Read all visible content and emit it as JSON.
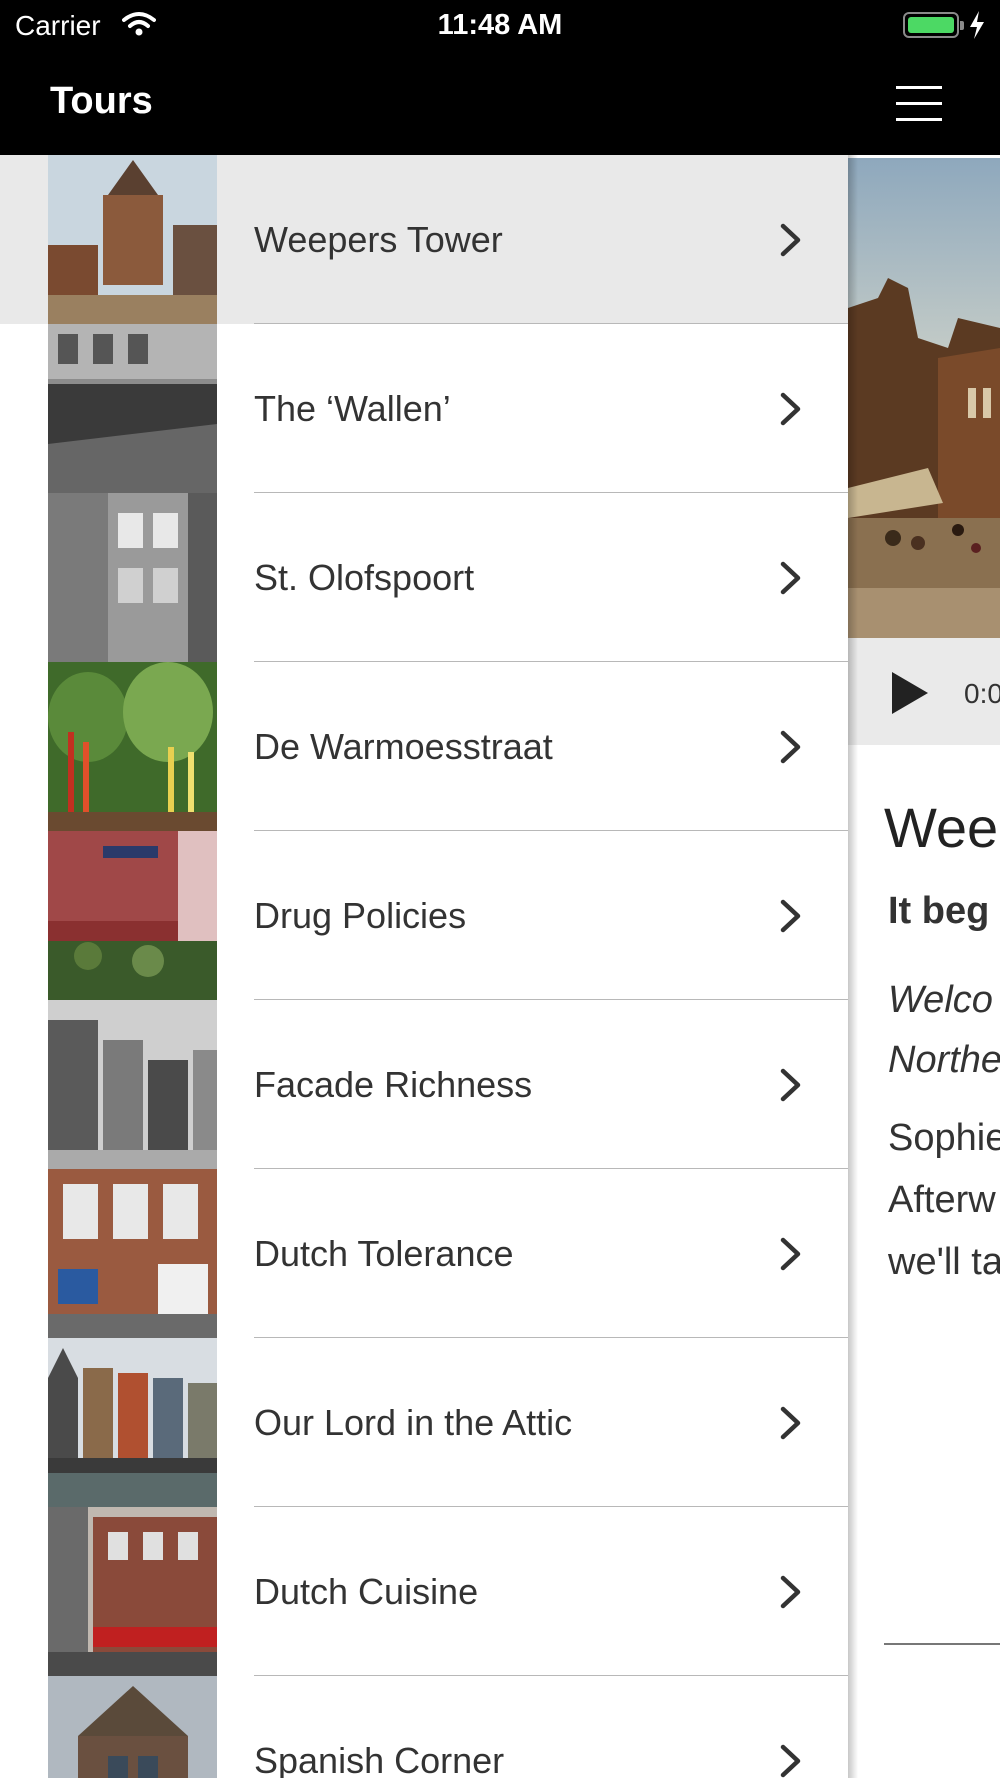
{
  "status_bar": {
    "carrier": "Carrier",
    "time": "11:48 AM"
  },
  "nav": {
    "title": "Tours",
    "menu_icon": "hamburger-menu-icon"
  },
  "tours": [
    {
      "label": "Weepers Tower",
      "selected": true
    },
    {
      "label": "The ‘Wallen’",
      "selected": false
    },
    {
      "label": "St. Olofspoort",
      "selected": false
    },
    {
      "label": "De Warmoesstraat",
      "selected": false
    },
    {
      "label": "Drug Policies",
      "selected": false
    },
    {
      "label": "Facade Richness",
      "selected": false
    },
    {
      "label": "Dutch Tolerance",
      "selected": false
    },
    {
      "label": "Our Lord in the Attic",
      "selected": false
    },
    {
      "label": "Dutch Cuisine",
      "selected": false
    },
    {
      "label": "Spanish Corner",
      "selected": false
    }
  ],
  "detail": {
    "player_time": "0:0",
    "title": "Wee",
    "lead": "It beg",
    "italic_lines": [
      "Welco",
      "Northe"
    ],
    "body_lines": [
      "Sophie",
      "Afterw",
      "we'll ta"
    ]
  },
  "colors": {
    "bar_background": "#000000",
    "selected_row": "#e9e9e9",
    "separator": "#b8b8b8",
    "battery": "#4cd964",
    "player_background": "#eaeaea"
  }
}
